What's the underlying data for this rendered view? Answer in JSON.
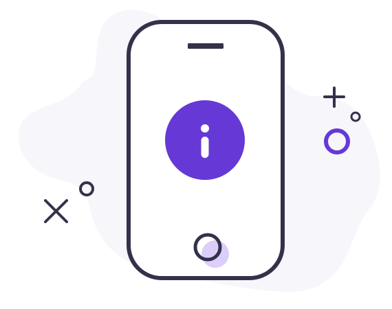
{
  "illustration": {
    "name": "phone-info-illustration",
    "icons": {
      "phone": "smartphone-icon",
      "info": "info-icon",
      "cross": "close-icon",
      "plus": "plus-icon",
      "small_circle_1": "ring-icon",
      "small_circle_2": "ring-icon",
      "accent_circle": "ring-icon"
    }
  },
  "colors": {
    "background_blob": "#F6F6FB",
    "stroke": "#34314A",
    "accent": "#6639D6",
    "accent_light": "#DCCEFA",
    "screen_fill": "#FFFFFF"
  }
}
